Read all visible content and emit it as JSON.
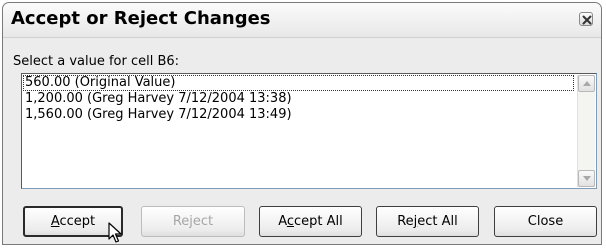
{
  "dialog": {
    "title": "Accept or Reject Changes",
    "prompt": "Select a value for cell B6:"
  },
  "list": {
    "items": [
      "560.00  (Original Value)",
      "1,200.00  (Greg Harvey 7/12/2004 13:38)",
      "1,560.00  (Greg Harvey 7/12/2004 13:49)"
    ],
    "selected_index": 0
  },
  "buttons": {
    "accept": {
      "pre": "",
      "key": "A",
      "post": "ccept"
    },
    "reject": {
      "pre": "Reject",
      "key": "",
      "post": ""
    },
    "accept_all": {
      "pre": "A",
      "key": "c",
      "post": "cept All"
    },
    "reject_all": {
      "pre": "Re",
      "key": "j",
      "post": "ect All"
    },
    "close": {
      "pre": "Close",
      "key": "",
      "post": ""
    }
  },
  "icons": {
    "close": "close-icon",
    "scroll_up": "scroll-up-arrow-icon",
    "scroll_down": "scroll-down-arrow-icon",
    "cursor": "mouse-pointer-icon"
  }
}
